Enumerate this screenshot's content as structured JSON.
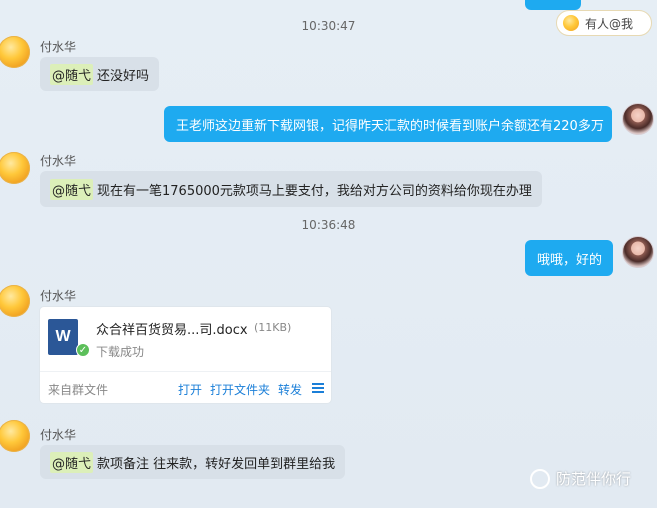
{
  "top_bubble_tail": "",
  "someone_at_me": {
    "label": "有人@我",
    "icon": "at-icon"
  },
  "timestamps": [
    "10:30:47",
    "10:36:48"
  ],
  "messages": [
    {
      "sender": "付水华",
      "mention": "@随弋",
      "text": "还没好吗"
    },
    {
      "text": "王老师这边重新下载网银，记得昨天汇款的时候看到账户余额还有220多万"
    },
    {
      "sender": "付水华",
      "mention": "@随弋",
      "text": "现在有一笔1765000元款项马上要支付，我给对方公司的资料给你现在办理"
    },
    {
      "text": "哦哦，好的"
    },
    {
      "sender": "付水华"
    },
    {
      "sender": "付水华",
      "mention": "@随弋",
      "text": "款项备注 往来款，转好发回单到群里给我"
    }
  ],
  "file": {
    "name": "众合祥百货贸易...司.docx",
    "size": "(11KB)",
    "icon_letter": "W",
    "status": "下载成功",
    "source": "来自群文件",
    "actions": [
      "打开",
      "打开文件夹",
      "转发"
    ]
  },
  "watermark": {
    "text": "防范伴你行"
  },
  "colors": {
    "outgoing_bubble": "#1eaaf0",
    "incoming_bubble": "#d8e0e8",
    "mention_highlight": "#dcefb9",
    "link": "#1b7fd8"
  }
}
